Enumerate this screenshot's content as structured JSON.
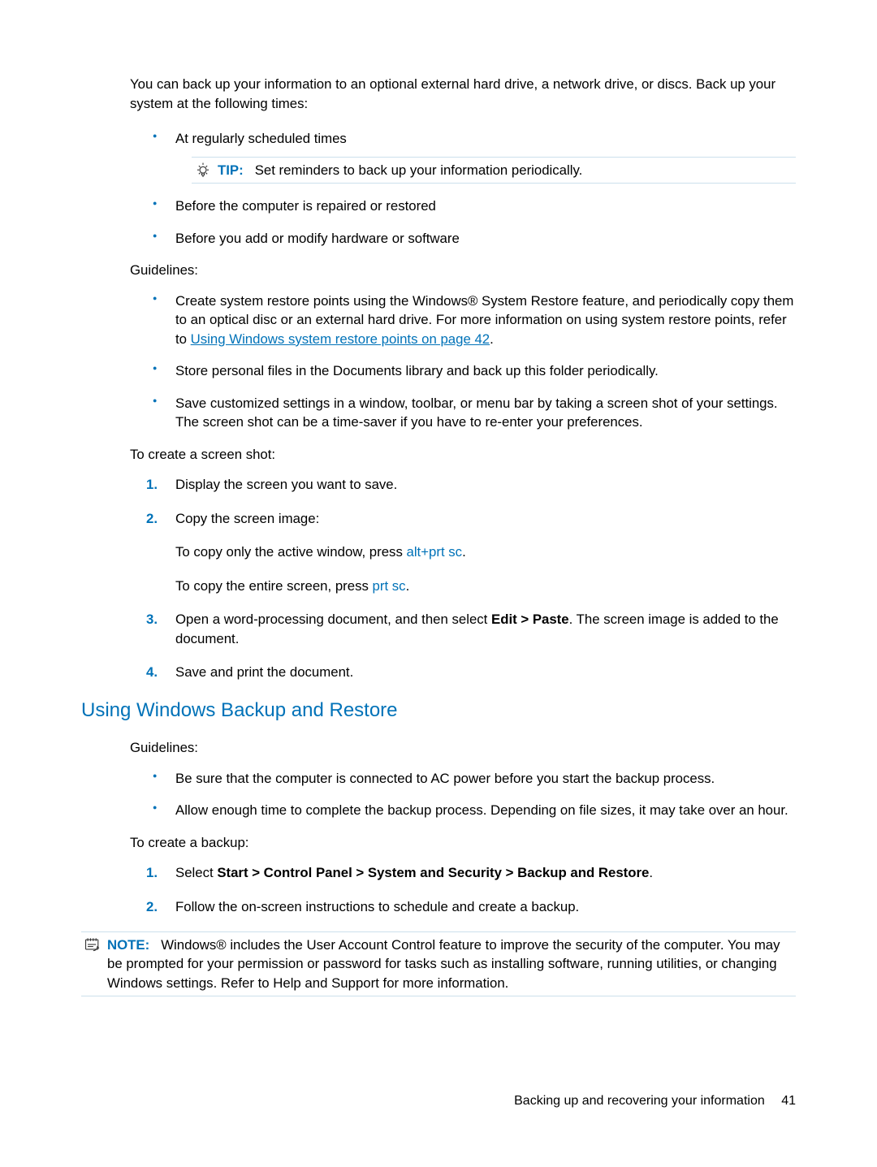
{
  "intro": "You can back up your information to an optional external hard drive, a network drive, or discs. Back up your system at the following times:",
  "bullets1": {
    "b1": "At regularly scheduled times",
    "tip_label": "TIP:",
    "tip_text": "Set reminders to back up your information periodically.",
    "b2": "Before the computer is repaired or restored",
    "b3": "Before you add or modify hardware or software"
  },
  "guidelines_label": "Guidelines:",
  "guidelines": {
    "g1_pre": "Create system restore points using the Windows® System Restore feature, and periodically copy them to an optical disc or an external hard drive. For more information on using system restore points, refer to ",
    "g1_link": "Using Windows system restore points on page 42",
    "g1_post": ".",
    "g2": "Store personal files in the Documents library and back up this folder periodically.",
    "g3": "Save customized settings in a window, toolbar, or menu bar by taking a screen shot of your settings. The screen shot can be a time-saver if you have to re-enter your preferences."
  },
  "screenshot_intro": "To create a screen shot:",
  "steps1": {
    "s1": "Display the screen you want to save.",
    "s2": "Copy the screen image:",
    "s2a_pre": "To copy only the active window, press ",
    "s2a_k1": "alt",
    "s2a_plus": "+",
    "s2a_k2": "prt sc",
    "s2a_post": ".",
    "s2b_pre": "To copy the entire screen, press ",
    "s2b_k1": "prt sc",
    "s2b_post": ".",
    "s3_pre": "Open a word-processing document, and then select ",
    "s3_bold": "Edit > Paste",
    "s3_post": ". The screen image is added to the document.",
    "s4": "Save and print the document."
  },
  "section_heading": "Using Windows Backup and Restore",
  "guidelines2_label": "Guidelines:",
  "guidelines2": {
    "g1": "Be sure that the computer is connected to AC power before you start the backup process.",
    "g2": "Allow enough time to complete the backup process. Depending on file sizes, it may take over an hour."
  },
  "backup_intro": "To create a backup:",
  "steps2": {
    "s1_pre": "Select ",
    "s1_bold": "Start > Control Panel > System and Security > Backup and Restore",
    "s1_post": ".",
    "s2": "Follow the on-screen instructions to schedule and create a backup."
  },
  "note": {
    "label": "NOTE:",
    "text": "Windows® includes the User Account Control feature to improve the security of the computer. You may be prompted for your permission or password for tasks such as installing software, running utilities, or changing Windows settings. Refer to Help and Support for more information."
  },
  "footer": {
    "text": "Backing up and recovering your information",
    "page": "41"
  }
}
